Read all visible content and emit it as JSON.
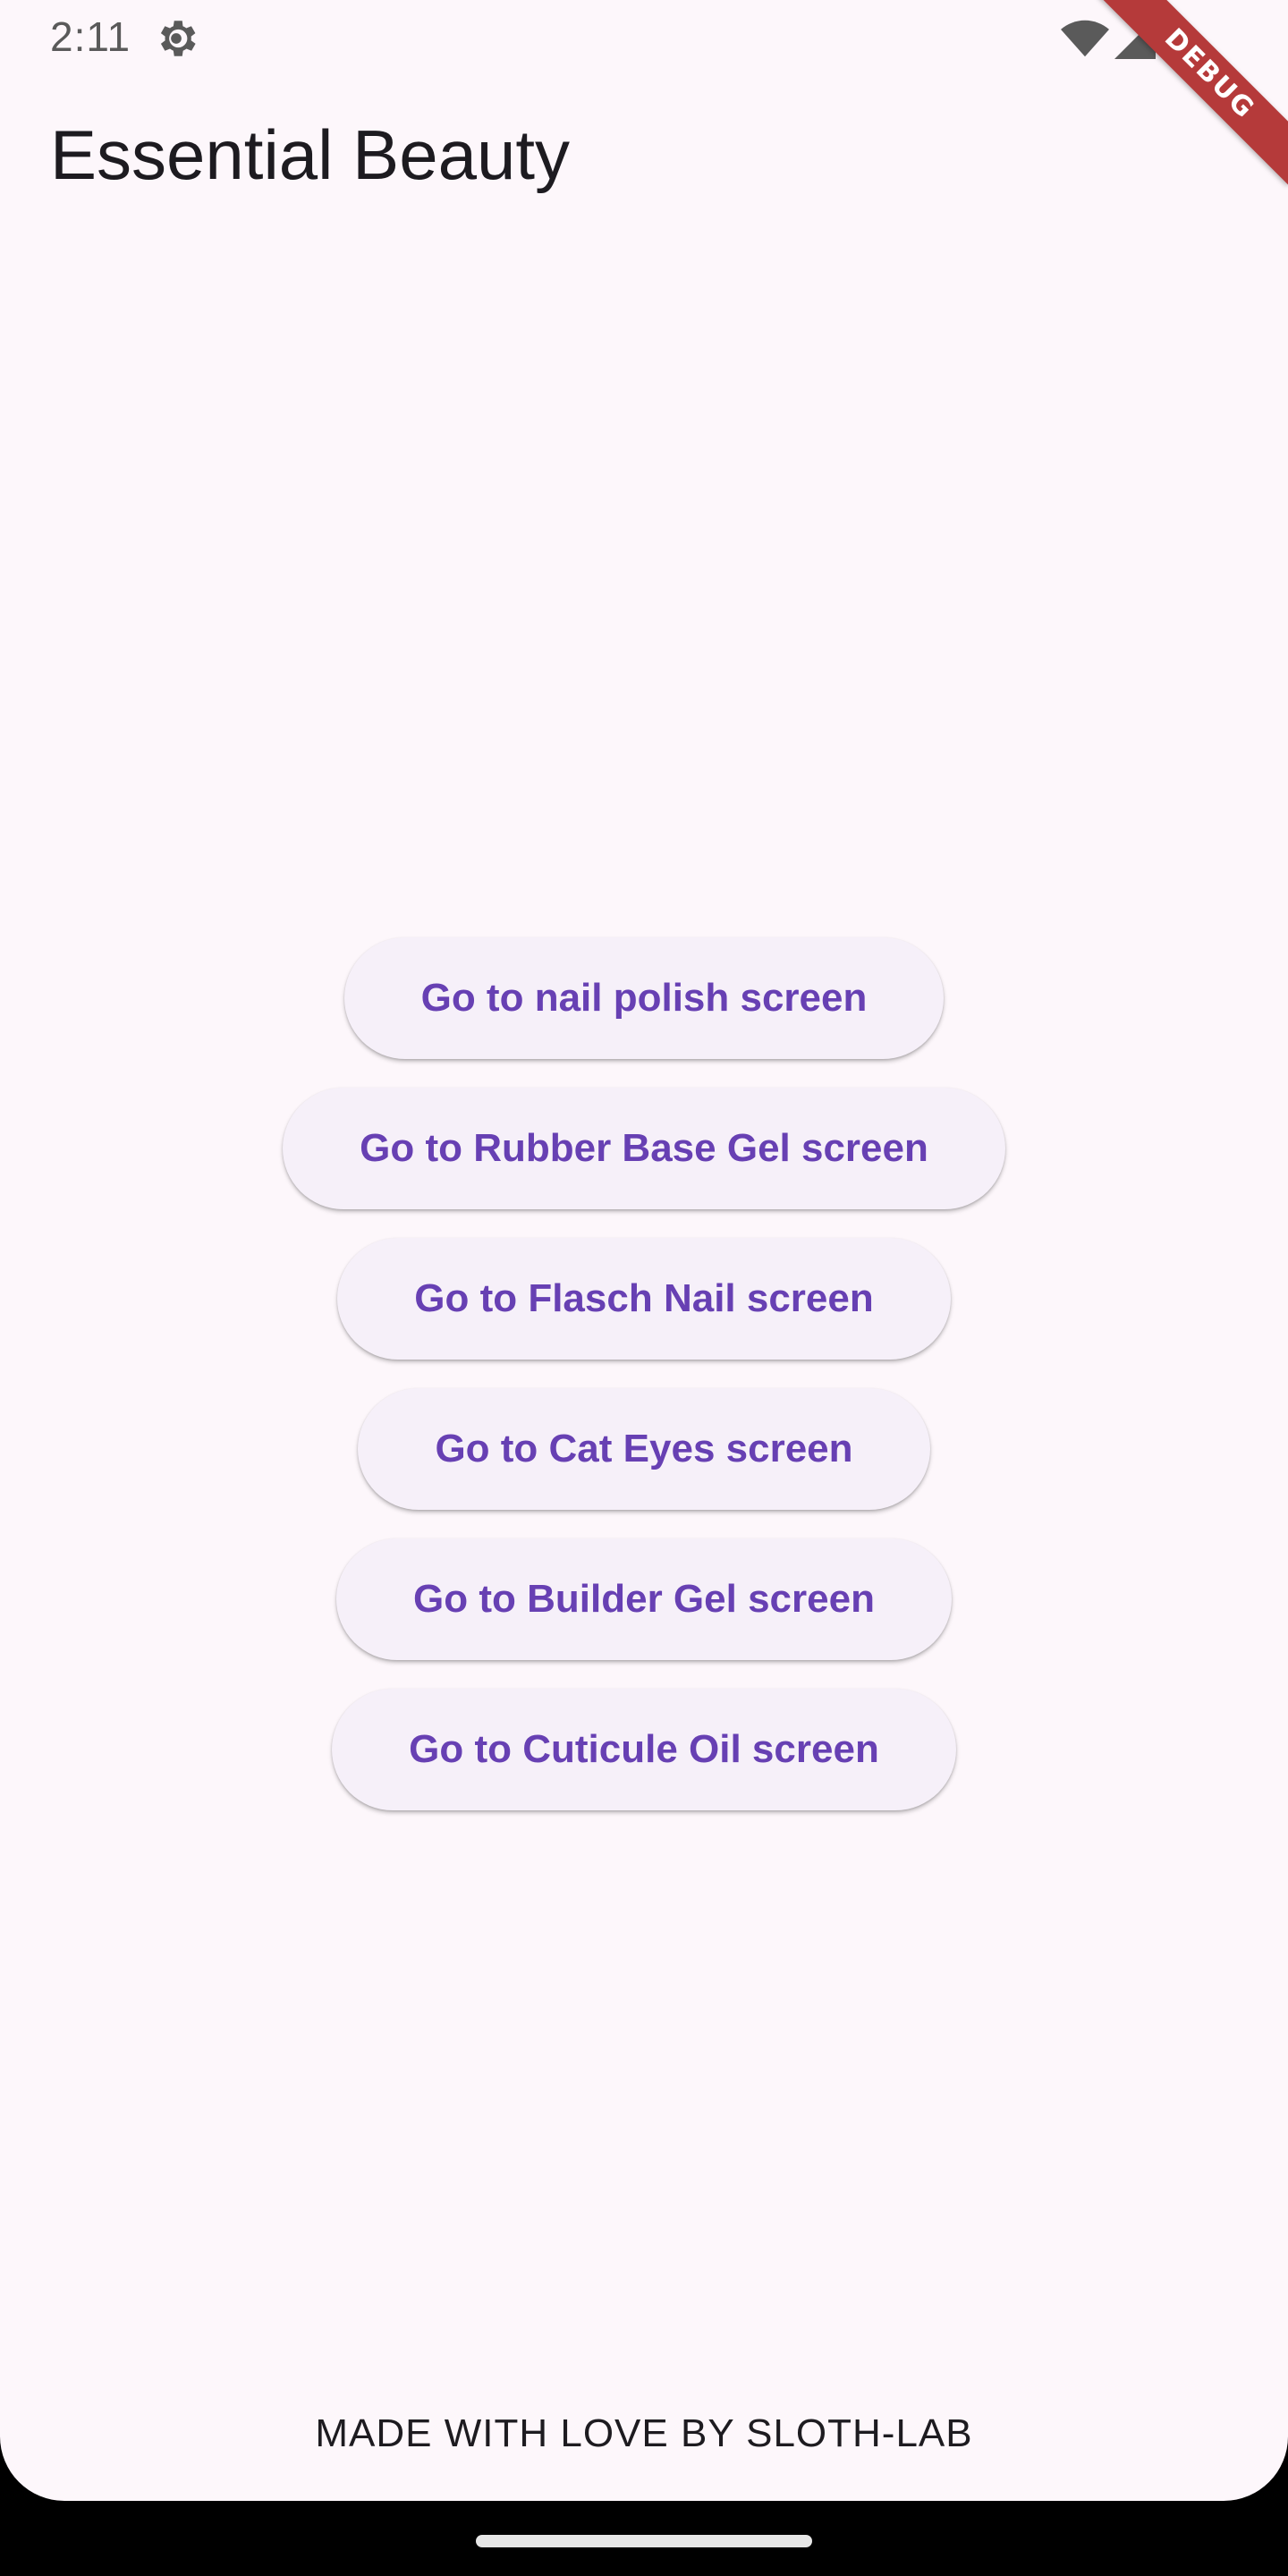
{
  "status_bar": {
    "time": "2:11",
    "icons": [
      "gear-icon",
      "wifi-icon",
      "cellular-signal-icon"
    ]
  },
  "debug_banner": {
    "label": "DEBUG",
    "color": "#b53a3a"
  },
  "app_bar": {
    "title": "Essential Beauty"
  },
  "buttons": [
    {
      "label": "Go to nail polish screen"
    },
    {
      "label": "Go to Rubber Base Gel screen"
    },
    {
      "label": "Go to Flasch Nail screen"
    },
    {
      "label": "Go to Cat Eyes screen"
    },
    {
      "label": "Go to Builder Gel screen"
    },
    {
      "label": "Go to Cuticule Oil screen"
    }
  ],
  "footer": {
    "text": "MADE WITH LOVE BY SLOTH-LAB"
  },
  "colors": {
    "background": "#fdf7fb",
    "button_background": "#f6f0f9",
    "button_text": "#6740b3",
    "nav_bar": "#000000"
  }
}
